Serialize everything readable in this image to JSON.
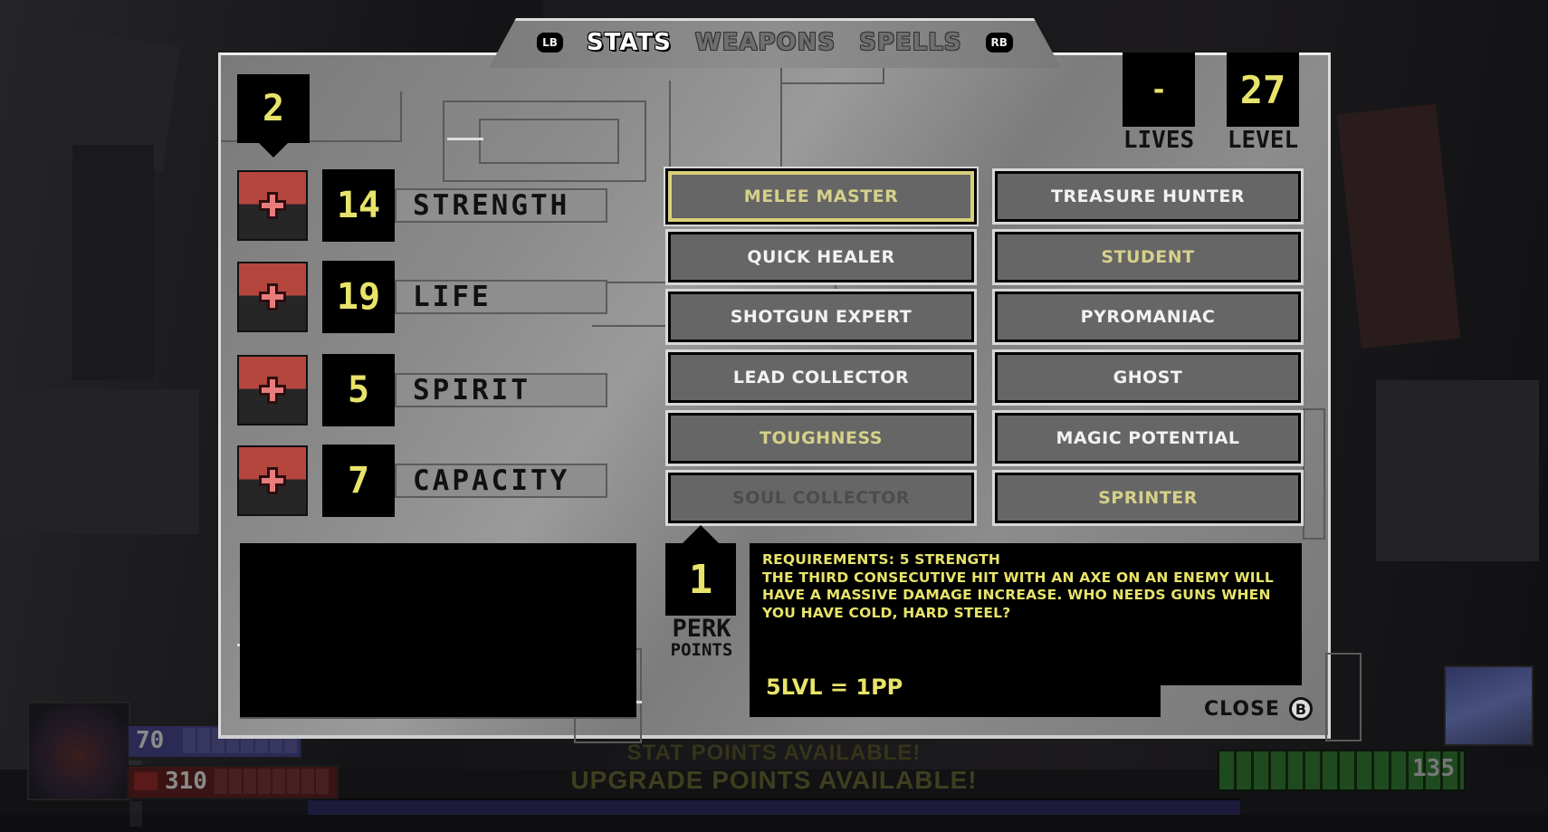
{
  "tabs": {
    "left_bumper": "LB",
    "right_bumper": "RB",
    "items": [
      {
        "label": "STATS",
        "active": true
      },
      {
        "label": "WEAPONS",
        "active": false
      },
      {
        "label": "SPELLS",
        "active": false
      }
    ]
  },
  "stat_points": "2",
  "stats": [
    {
      "name": "STRENGTH",
      "value": "14",
      "icon": "plus-icon"
    },
    {
      "name": "LIFE",
      "value": "19",
      "icon": "plus-icon"
    },
    {
      "name": "SPIRIT",
      "value": "5",
      "icon": "plus-icon"
    },
    {
      "name": "CAPACITY",
      "value": "7",
      "icon": "plus-icon"
    }
  ],
  "lives": {
    "label": "LIVES",
    "value": "-"
  },
  "level": {
    "label": "LEVEL",
    "value": "27"
  },
  "perks": [
    {
      "label": "MELEE MASTER",
      "state": "selected"
    },
    {
      "label": "TREASURE HUNTER",
      "state": "available"
    },
    {
      "label": "QUICK HEALER",
      "state": "available"
    },
    {
      "label": "STUDENT",
      "state": "owned"
    },
    {
      "label": "SHOTGUN EXPERT",
      "state": "available"
    },
    {
      "label": "PYROMANIAC",
      "state": "available"
    },
    {
      "label": "LEAD COLLECTOR",
      "state": "available"
    },
    {
      "label": "GHOST",
      "state": "available"
    },
    {
      "label": "TOUGHNESS",
      "state": "owned"
    },
    {
      "label": "MAGIC POTENTIAL",
      "state": "available"
    },
    {
      "label": "SOUL COLLECTOR",
      "state": "locked"
    },
    {
      "label": "SPRINTER",
      "state": "owned"
    }
  ],
  "perk_points": {
    "value": "1",
    "label_line1": "PERK",
    "label_line2": "POINTS"
  },
  "description": {
    "requirements": "REQUIREMENTS: 5 STRENGTH",
    "body": "THE THIRD CONSECUTIVE HIT WITH AN AXE ON AN ENEMY WILL HAVE A MASSIVE DAMAGE INCREASE. WHO NEEDS GUNS WHEN YOU HAVE COLD, HARD STEEL?",
    "rate": "5LVL = 1PP"
  },
  "close": {
    "label": "CLOSE",
    "button": "B"
  },
  "hud": {
    "armor": "70",
    "health": "310",
    "ammo": "135",
    "notice_1": "STAT POINTS AVAILABLE!",
    "notice_2": "UPGRADE POINTS AVAILABLE!"
  },
  "colors": {
    "accent_yellow": "#e8e36a",
    "owned_yellow": "#d6d08a",
    "stat_red": "#b5463e",
    "panel_gray": "#888888"
  }
}
